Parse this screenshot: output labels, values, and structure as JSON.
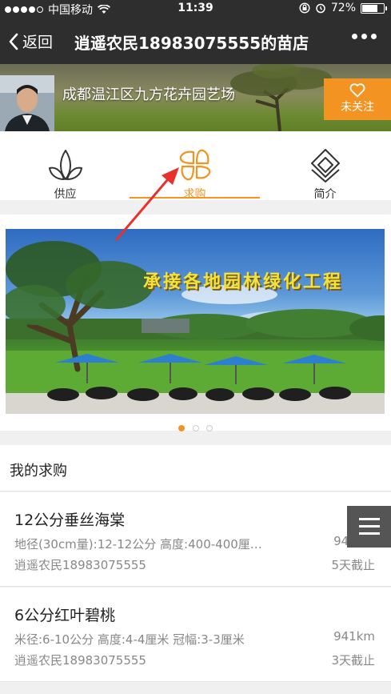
{
  "status_bar": {
    "carrier": "中国移动",
    "time": "11:39",
    "battery": "72%",
    "battery_level": 0.72
  },
  "nav": {
    "back_label": "返回",
    "title": "逍遥农民18983075555的苗店"
  },
  "shop": {
    "name": "成都温江区九方花卉园艺场",
    "follow_label": "未关注"
  },
  "tabs": [
    {
      "label": "供应",
      "icon": "leaf-icon"
    },
    {
      "label": "求购",
      "icon": "flower-icon",
      "active": true
    },
    {
      "label": "简介",
      "icon": "layers-icon"
    }
  ],
  "carousel": {
    "slide_title": "承接各地园林绿化工程",
    "dot_count": 3,
    "active_dot": 0
  },
  "section": {
    "title": "我的求购"
  },
  "demands": [
    {
      "name": "12公分垂丝海棠",
      "specs": "地径(30cm量):12-12公分 高度:400-400厘…",
      "seller": "逍遥农民18983075555",
      "distance": "941km",
      "deadline": "5天截止"
    },
    {
      "name": "6公分红叶碧桃",
      "specs": "米径:6-10公分 高度:4-4厘米 冠幅:3-3厘米",
      "seller": "逍遥农民18983075555",
      "distance": "941km",
      "deadline": "3天截止"
    }
  ],
  "colors": {
    "accent": "#f39322",
    "nav_bg": "#2e2e2e",
    "arrow": "#e8312c"
  }
}
